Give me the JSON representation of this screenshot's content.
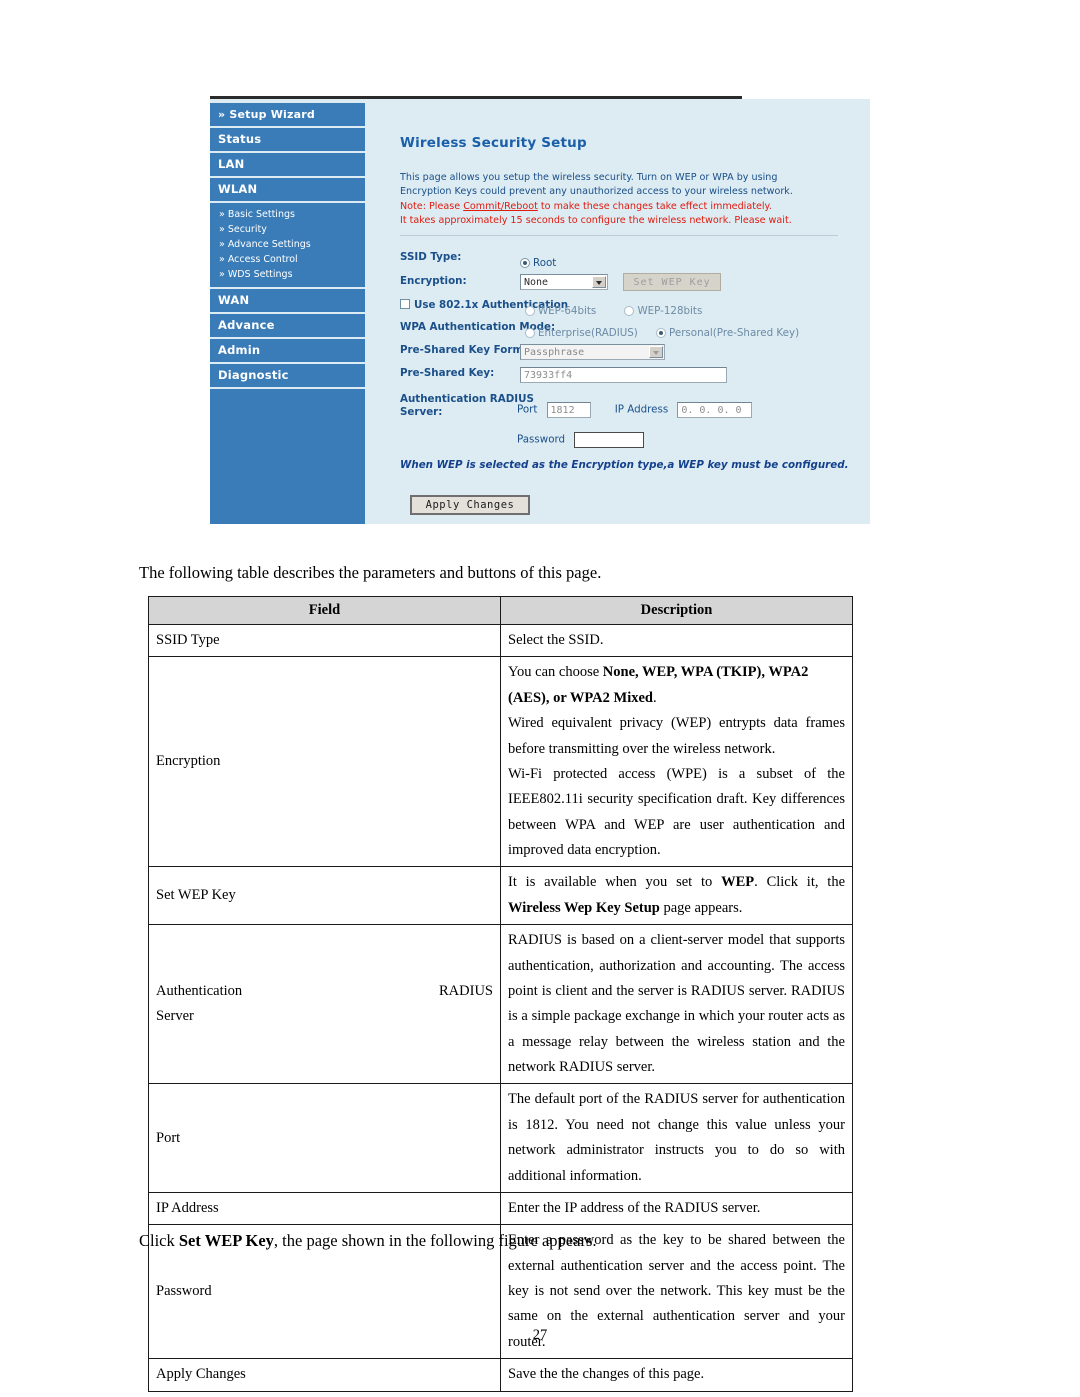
{
  "figure": {
    "sidebar": {
      "main_items": [
        {
          "label": "» Setup Wizard"
        },
        {
          "label": "Status"
        },
        {
          "label": "LAN"
        },
        {
          "label": "WLAN"
        }
      ],
      "sub_items": [
        {
          "chevron": "»",
          "label": "Basic Settings"
        },
        {
          "chevron": "»",
          "label": "Security"
        },
        {
          "chevron": "»",
          "label": "Advance Settings"
        },
        {
          "chevron": "»",
          "label": "Access Control"
        },
        {
          "chevron": "»",
          "label": "WDS Settings"
        }
      ],
      "tail_items": [
        {
          "label": "WAN"
        },
        {
          "label": "Advance"
        },
        {
          "label": "Admin"
        },
        {
          "label": "Diagnostic"
        }
      ]
    },
    "page_title": "Wireless Security Setup",
    "description": {
      "line1": "This page allows you setup the wireless security. Turn on WEP or WPA by using",
      "line2": "Encryption Keys could prevent any unauthorized access to your wireless network.",
      "note_prefix": "Note: Please ",
      "note_link": "Commit/Reboot",
      "note_suffix": " to make these changes take effect immediately.",
      "note_line2": "It takes approximately 15 seconds to configure the wireless network. Please wait."
    },
    "form": {
      "ssid_type_label": "SSID Type:",
      "ssid_type_option": "Root",
      "encryption_label": "Encryption:",
      "encryption_value": "None",
      "set_wep_key_button": "Set WEP Key",
      "use_8021x_label": "Use 802.1x Authentication",
      "wep64_label": "WEP-64bits",
      "wep128_label": "WEP-128bits",
      "wpa_auth_mode_label": "WPA Authentication Mode:",
      "wpa_enterprise_label": "Enterprise(RADIUS)",
      "wpa_personal_label": "Personal(Pre-Shared Key)",
      "psk_format_label": "Pre-Shared Key Format:",
      "psk_format_value": "Passphrase",
      "psk_label": "Pre-Shared Key:",
      "psk_value": "73933ff4",
      "radius_label_line1": "Authentication RADIUS",
      "radius_label_line2": "Server:",
      "port_label": "Port",
      "port_value": "1812",
      "ip_address_label": "IP Address",
      "ip_address_value": "0. 0. 0. 0",
      "password_label": "Password",
      "password_value": "",
      "wep_note": "When WEP is selected as the Encryption type,a WEP key must be configured.",
      "apply_button": "Apply Changes"
    },
    "colors": {
      "sidebar_blue": "#3a7cb8",
      "panel_bg": "#dcecf2",
      "title_blue": "#1a5fa8",
      "body_blue": "#1b4f8a",
      "warning_red": "#e01b10"
    }
  },
  "document": {
    "intro_paragraph": "The following table describes the parameters and buttons of this page.",
    "closing_prefix": "Click ",
    "closing_bold": "Set WEP Key",
    "closing_suffix": ", the page shown in the following figure appears.",
    "page_number": "27",
    "table": {
      "headers": {
        "field": "Field",
        "description": "Description"
      },
      "rows": [
        {
          "field": "SSID Type",
          "description_paragraphs": [
            "Select the SSID."
          ]
        },
        {
          "field": "Encryption",
          "description_paragraphs": [
            "You can choose None, WEP, WPA (TKIP), WPA2 (AES), or WPA2 Mixed.",
            "Wired equivalent privacy (WEP) entrypts data frames before transmitting over the wireless network.",
            "Wi-Fi protected access (WPE) is a subset of the IEEE802.11i security specification draft. Key differences between WPA and WEP are user authentication and improved data encryption."
          ]
        },
        {
          "field": "Set WEP Key",
          "description_paragraphs": [
            "It is available when you set to WEP. Click it, the Wireless Wep Key Setup page appears."
          ]
        },
        {
          "field": "Authentication RADIUS Server",
          "description_paragraphs": [
            "RADIUS is based on a client-server model that supports authentication, authorization and accounting. The access point is client and the server is RADIUS server. RADIUS is a simple package exchange in which your router acts as a message relay between the wireless station and the network RADIUS server."
          ]
        },
        {
          "field": "Port",
          "description_paragraphs": [
            "The default port of the RADIUS server for authentication is 1812. You need not change this value unless your network administrator instructs you to do so with additional information."
          ]
        },
        {
          "field": "IP Address",
          "description_paragraphs": [
            "Enter the IP address of the RADIUS server."
          ]
        },
        {
          "field": "Password",
          "description_paragraphs": [
            "Enter a password as the key to be shared between the external authentication server and the access point. The key is not send over the network. This key must be the same on the external authentication server and your router."
          ]
        },
        {
          "field": "Apply Changes",
          "description_paragraphs": [
            "Save the the changes of this page."
          ]
        }
      ]
    }
  }
}
